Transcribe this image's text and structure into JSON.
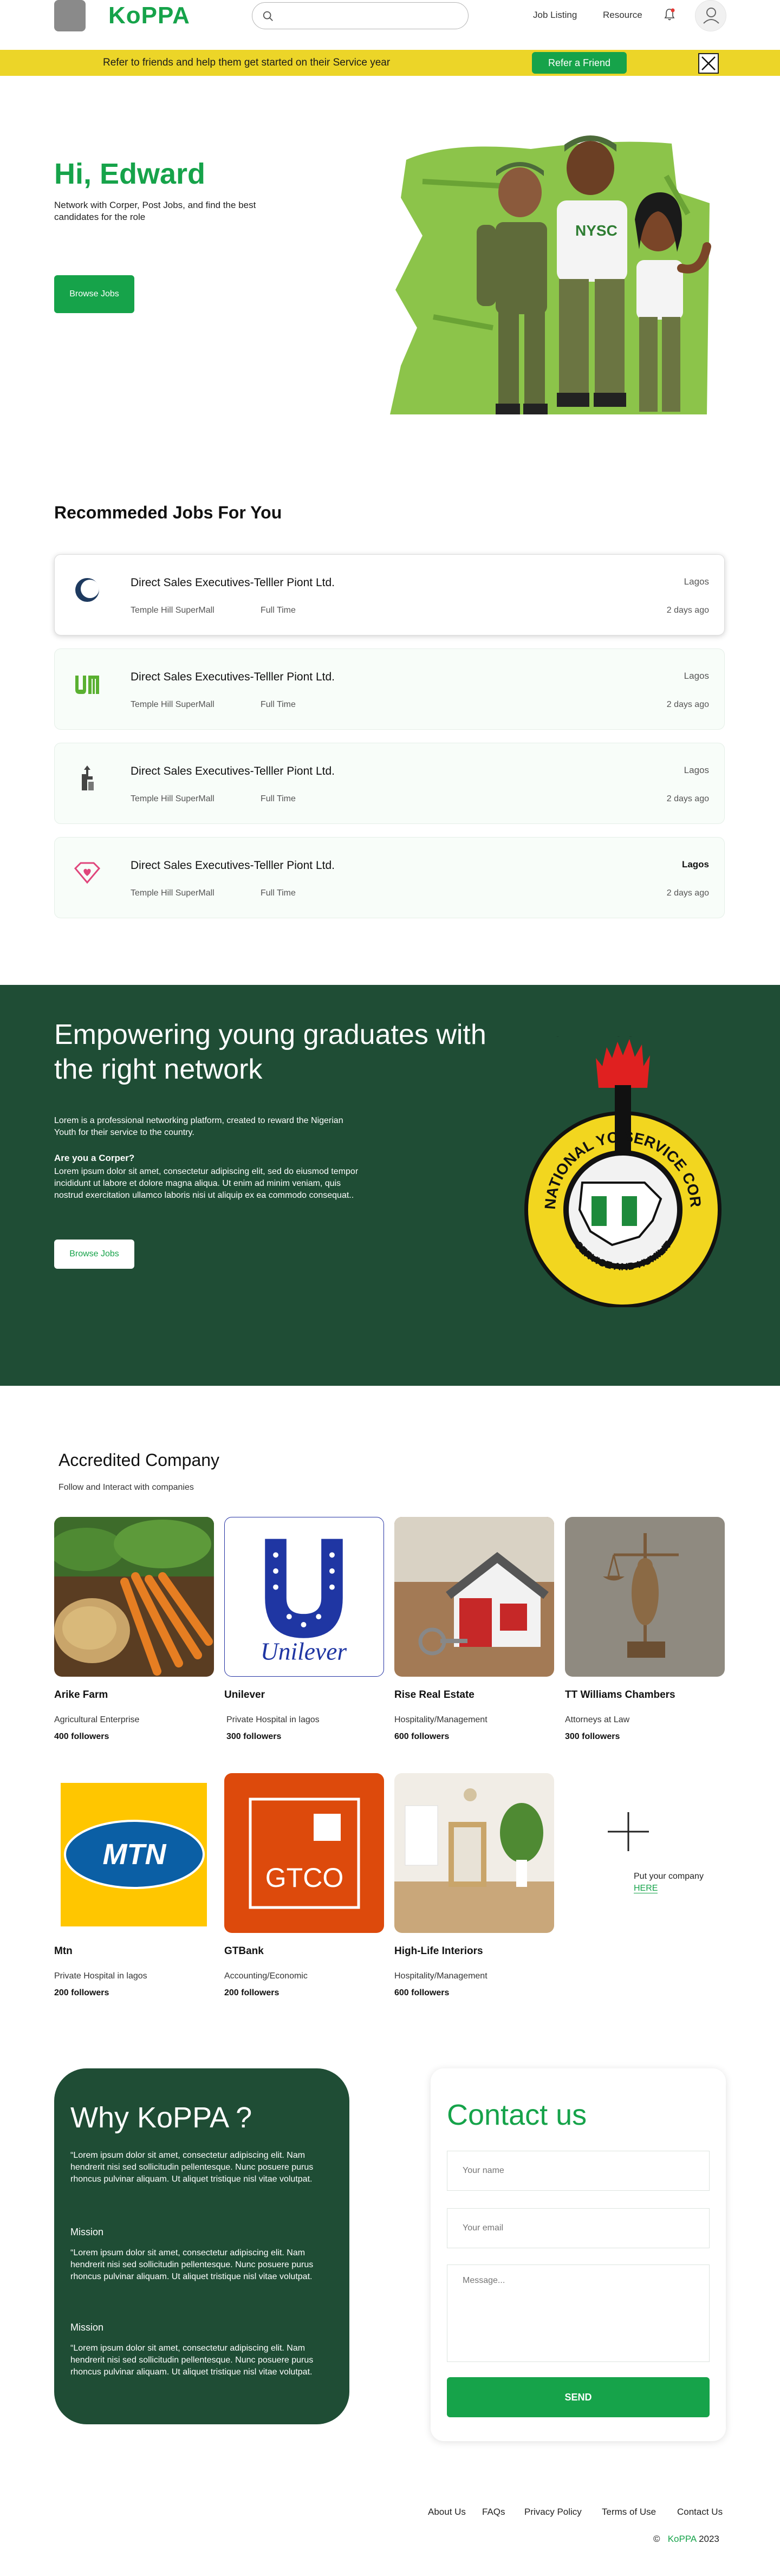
{
  "nav": {
    "brand": "KoPPA",
    "search_placeholder": "",
    "links": [
      "Job Listing",
      "Resource"
    ]
  },
  "banner": {
    "text": "Refer to friends and help them get started on their Service year",
    "button": "Refer a Friend"
  },
  "hero": {
    "title": "Hi, Edward",
    "subtitle": "Network with Corper, Post Jobs, and find the best candidates for the role",
    "button": "Browse Jobs"
  },
  "jobs": {
    "title": "Recommeded Jobs For You",
    "items": [
      {
        "title": "Direct Sales Executives-Telller Piont Ltd.",
        "company": "Temple Hill SuperMall",
        "type": "Full Time",
        "location": "Lagos",
        "posted": "2 days ago",
        "logo": "crescent-logo-icon"
      },
      {
        "title": "Direct Sales Executives-Telller Piont Ltd.",
        "company": "Temple Hill SuperMall",
        "type": "Full Time",
        "location": "Lagos",
        "posted": "2 days ago",
        "logo": "um-logo-icon"
      },
      {
        "title": "Direct Sales Executives-Telller Piont Ltd.",
        "company": "Temple Hill SuperMall",
        "type": "Full Time",
        "location": "Lagos",
        "posted": "2 days ago",
        "logo": "tower-logo-icon"
      },
      {
        "title": "Direct Sales Executives-Telller Piont Ltd.",
        "company": "Temple Hill SuperMall",
        "type": "Full Time",
        "location": "Lagos",
        "posted": "2 days ago",
        "logo": "diamond-heart-logo-icon"
      }
    ]
  },
  "empower": {
    "title": "Empowering young graduates with the right network",
    "intro": "Lorem is a professional networking platform, created to reward the Nigerian Youth for their service to the country.",
    "heading": "Are you a Corper?",
    "body": "Lorem ipsum dolor sit amet, consectetur adipiscing elit, sed do eiusmod tempor incididunt ut labore et dolore magna aliqua. Ut enim ad minim veniam, quis nostrud exercitation ullamco laboris nisi ut aliquip ex ea commodo consequat..",
    "button": "Browse Jobs",
    "logo_top": "NATIONAL YOUTH",
    "logo_right": "SERVICE CORPS",
    "logo_bottom": "SERVICE AND HUMILITY"
  },
  "accredited": {
    "title": "Accredited Company",
    "subtitle": "Follow and Interact with companies",
    "companies": [
      {
        "name": "Arike Farm",
        "category": "Agricultural Enterprise",
        "followers": "400 followers"
      },
      {
        "name": "Unilever",
        "category": "Private Hospital in lagos",
        "followers": "300 followers",
        "logo_text": "Unilever"
      },
      {
        "name": "Rise Real Estate",
        "category": "Hospitality/Management",
        "followers": "600 followers"
      },
      {
        "name": "TT Williams Chambers",
        "category": "Attorneys at Law",
        "followers": "300 followers"
      },
      {
        "name": "Mtn",
        "category": "Private Hospital in lagos",
        "followers": "200 followers",
        "logo_text": "MTN"
      },
      {
        "name": "GTBank",
        "category": "Accounting/Economic",
        "followers": "200 followers",
        "logo_text": "GTCO"
      },
      {
        "name": "High-Life Interiors",
        "category": "Hospitality/Management",
        "followers": "600 followers"
      }
    ],
    "add_text": "Put your company",
    "add_link": "HERE"
  },
  "why": {
    "title": "Why KoPPA ?",
    "para1": "“Lorem ipsum dolor sit amet, consectetur adipiscing elit. Nam hendrerit nisi sed sollicitudin pellentesque. Nunc posuere purus rhoncus pulvinar aliquam. Ut aliquet tristique nisl vitae volutpat.",
    "mission1_title": "Mission",
    "mission1": "“Lorem ipsum dolor sit amet, consectetur adipiscing elit. Nam hendrerit nisi sed sollicitudin pellentesque. Nunc posuere purus rhoncus pulvinar aliquam. Ut aliquet tristique nisl vitae volutpat.",
    "mission2_title": "Mission",
    "mission2": "“Lorem ipsum dolor sit amet, consectetur adipiscing elit. Nam hendrerit nisi sed sollicitudin pellentesque. Nunc posuere purus rhoncus pulvinar aliquam. Ut aliquet tristique nisl vitae volutpat."
  },
  "contact": {
    "title": "Contact us",
    "name_placeholder": "Your name",
    "email_placeholder": "Your email",
    "message_placeholder": "Message...",
    "button": "SEND"
  },
  "footer": {
    "links": [
      "About Us",
      "FAQs",
      "Privacy Policy",
      "Terms of Use",
      "Contact Us"
    ],
    "copyright_symbol": "©",
    "brand": "KoPPA",
    "year": "2023"
  },
  "colors": {
    "brand_green": "#16a34a",
    "dark_green": "#1f4d35",
    "banner_yellow": "#ecd528"
  }
}
